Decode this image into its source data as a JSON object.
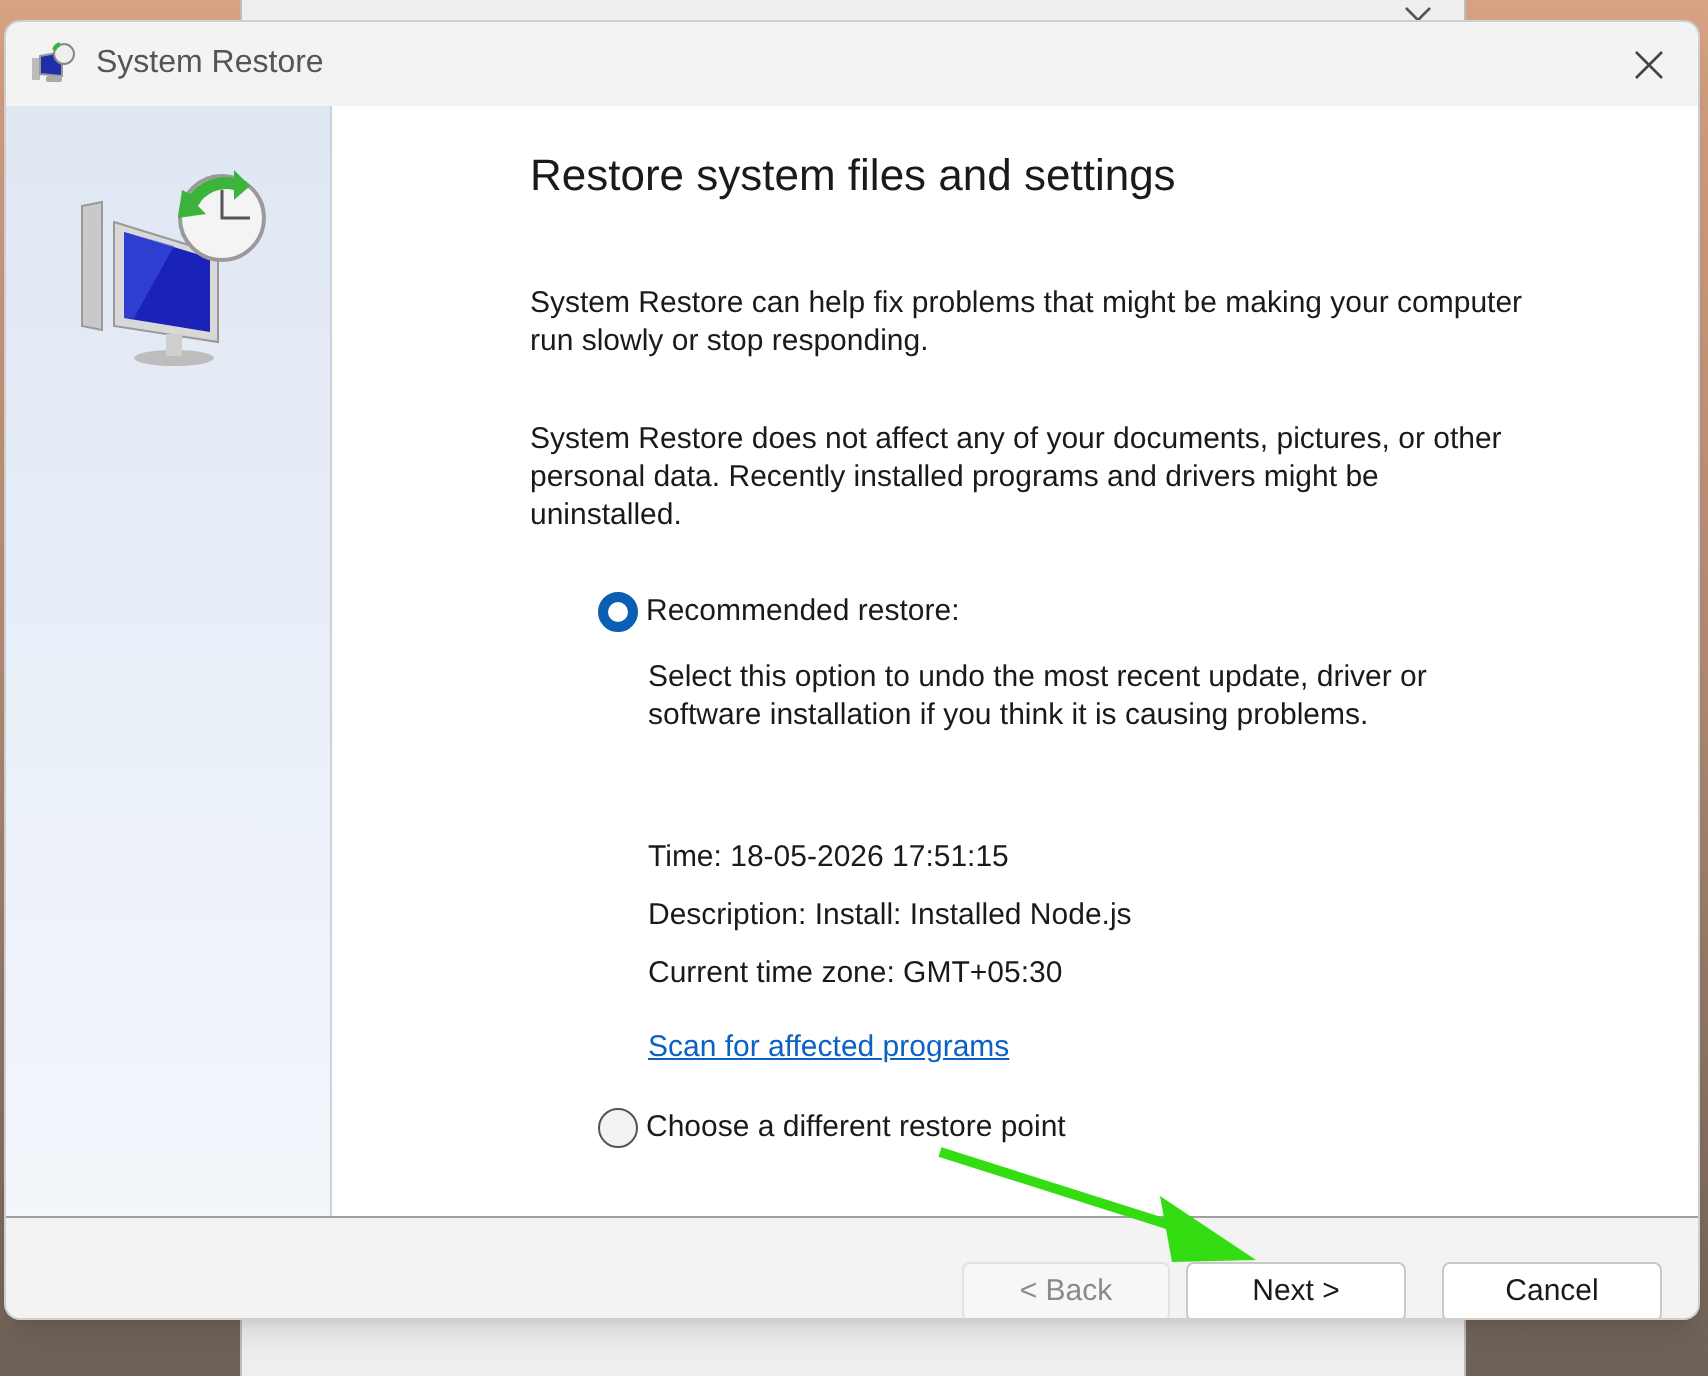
{
  "window": {
    "title": "System Restore"
  },
  "heading": "Restore system files and settings",
  "paragraphs": [
    "System Restore can help fix problems that might be making your computer run slowly or stop responding.",
    "System Restore does not affect any of your documents, pictures, or other personal data. Recently installed programs and drivers might be uninstalled."
  ],
  "options": [
    {
      "label": "Recommended restore:",
      "selected": true,
      "description": "Select this option to undo the most recent update, driver or software installation if you think it is causing problems.",
      "details": [
        "Time: 18-05-2026 17:51:15",
        "Description: Install: Installed Node.js",
        "Current time zone: GMT+05:30"
      ],
      "link": "Scan for affected programs"
    },
    {
      "label": "Choose a different restore point",
      "selected": false
    }
  ],
  "buttons": [
    {
      "label": "< Back",
      "disabled": true
    },
    {
      "label": "Next >",
      "disabled": false
    },
    {
      "label": "Cancel",
      "disabled": false
    }
  ]
}
